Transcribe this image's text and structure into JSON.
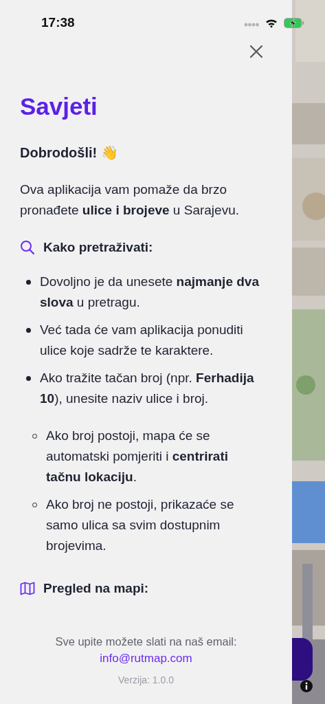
{
  "status_bar": {
    "time": "17:38"
  },
  "panel": {
    "title": "Savjeti",
    "greeting": "Dobrodošli! 👋",
    "intro": "Ova aplikacija vam pomaže da brzo pronađete **ulice i brojeve** u Sarajevu.",
    "sections": [
      {
        "kind": "search",
        "heading": "Kako pretraživati:",
        "items": [
          {
            "text": "Dovoljno je da unesete **najmanje dva slova** u pretragu."
          },
          {
            "text": "Već tada će vam aplikacija ponuditi ulice koje sadrže te karaktere."
          },
          {
            "text": "Ako tražite tačan broj (npr. **Ferhadija 10**), unesite naziv ulice i broj.",
            "children": [
              {
                "text": "Ako broj postoji, mapa će se automatski pomjeriti i **centrirati tačnu lokaciju**."
              },
              {
                "text": "Ako broj ne postoji, prikazaće se samo ulica sa svim dostupnim brojevima."
              }
            ]
          }
        ]
      },
      {
        "kind": "map",
        "heading": "Pregled na mapi:"
      }
    ]
  },
  "footer": {
    "contact_text": "Sve upite možete slati na naš email:",
    "email": "info@rutmap.com",
    "version": "Verzija: 1.0.0"
  }
}
